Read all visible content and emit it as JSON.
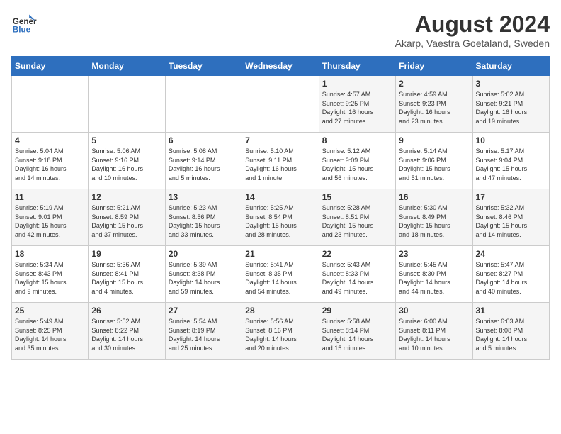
{
  "header": {
    "logo_line1": "General",
    "logo_line2": "Blue",
    "title": "August 2024",
    "location": "Akarp, Vaestra Goetaland, Sweden"
  },
  "days_of_week": [
    "Sunday",
    "Monday",
    "Tuesday",
    "Wednesday",
    "Thursday",
    "Friday",
    "Saturday"
  ],
  "weeks": [
    [
      {
        "day": "",
        "info": ""
      },
      {
        "day": "",
        "info": ""
      },
      {
        "day": "",
        "info": ""
      },
      {
        "day": "",
        "info": ""
      },
      {
        "day": "1",
        "info": "Sunrise: 4:57 AM\nSunset: 9:25 PM\nDaylight: 16 hours\nand 27 minutes."
      },
      {
        "day": "2",
        "info": "Sunrise: 4:59 AM\nSunset: 9:23 PM\nDaylight: 16 hours\nand 23 minutes."
      },
      {
        "day": "3",
        "info": "Sunrise: 5:02 AM\nSunset: 9:21 PM\nDaylight: 16 hours\nand 19 minutes."
      }
    ],
    [
      {
        "day": "4",
        "info": "Sunrise: 5:04 AM\nSunset: 9:18 PM\nDaylight: 16 hours\nand 14 minutes."
      },
      {
        "day": "5",
        "info": "Sunrise: 5:06 AM\nSunset: 9:16 PM\nDaylight: 16 hours\nand 10 minutes."
      },
      {
        "day": "6",
        "info": "Sunrise: 5:08 AM\nSunset: 9:14 PM\nDaylight: 16 hours\nand 5 minutes."
      },
      {
        "day": "7",
        "info": "Sunrise: 5:10 AM\nSunset: 9:11 PM\nDaylight: 16 hours\nand 1 minute."
      },
      {
        "day": "8",
        "info": "Sunrise: 5:12 AM\nSunset: 9:09 PM\nDaylight: 15 hours\nand 56 minutes."
      },
      {
        "day": "9",
        "info": "Sunrise: 5:14 AM\nSunset: 9:06 PM\nDaylight: 15 hours\nand 51 minutes."
      },
      {
        "day": "10",
        "info": "Sunrise: 5:17 AM\nSunset: 9:04 PM\nDaylight: 15 hours\nand 47 minutes."
      }
    ],
    [
      {
        "day": "11",
        "info": "Sunrise: 5:19 AM\nSunset: 9:01 PM\nDaylight: 15 hours\nand 42 minutes."
      },
      {
        "day": "12",
        "info": "Sunrise: 5:21 AM\nSunset: 8:59 PM\nDaylight: 15 hours\nand 37 minutes."
      },
      {
        "day": "13",
        "info": "Sunrise: 5:23 AM\nSunset: 8:56 PM\nDaylight: 15 hours\nand 33 minutes."
      },
      {
        "day": "14",
        "info": "Sunrise: 5:25 AM\nSunset: 8:54 PM\nDaylight: 15 hours\nand 28 minutes."
      },
      {
        "day": "15",
        "info": "Sunrise: 5:28 AM\nSunset: 8:51 PM\nDaylight: 15 hours\nand 23 minutes."
      },
      {
        "day": "16",
        "info": "Sunrise: 5:30 AM\nSunset: 8:49 PM\nDaylight: 15 hours\nand 18 minutes."
      },
      {
        "day": "17",
        "info": "Sunrise: 5:32 AM\nSunset: 8:46 PM\nDaylight: 15 hours\nand 14 minutes."
      }
    ],
    [
      {
        "day": "18",
        "info": "Sunrise: 5:34 AM\nSunset: 8:43 PM\nDaylight: 15 hours\nand 9 minutes."
      },
      {
        "day": "19",
        "info": "Sunrise: 5:36 AM\nSunset: 8:41 PM\nDaylight: 15 hours\nand 4 minutes."
      },
      {
        "day": "20",
        "info": "Sunrise: 5:39 AM\nSunset: 8:38 PM\nDaylight: 14 hours\nand 59 minutes."
      },
      {
        "day": "21",
        "info": "Sunrise: 5:41 AM\nSunset: 8:35 PM\nDaylight: 14 hours\nand 54 minutes."
      },
      {
        "day": "22",
        "info": "Sunrise: 5:43 AM\nSunset: 8:33 PM\nDaylight: 14 hours\nand 49 minutes."
      },
      {
        "day": "23",
        "info": "Sunrise: 5:45 AM\nSunset: 8:30 PM\nDaylight: 14 hours\nand 44 minutes."
      },
      {
        "day": "24",
        "info": "Sunrise: 5:47 AM\nSunset: 8:27 PM\nDaylight: 14 hours\nand 40 minutes."
      }
    ],
    [
      {
        "day": "25",
        "info": "Sunrise: 5:49 AM\nSunset: 8:25 PM\nDaylight: 14 hours\nand 35 minutes."
      },
      {
        "day": "26",
        "info": "Sunrise: 5:52 AM\nSunset: 8:22 PM\nDaylight: 14 hours\nand 30 minutes."
      },
      {
        "day": "27",
        "info": "Sunrise: 5:54 AM\nSunset: 8:19 PM\nDaylight: 14 hours\nand 25 minutes."
      },
      {
        "day": "28",
        "info": "Sunrise: 5:56 AM\nSunset: 8:16 PM\nDaylight: 14 hours\nand 20 minutes."
      },
      {
        "day": "29",
        "info": "Sunrise: 5:58 AM\nSunset: 8:14 PM\nDaylight: 14 hours\nand 15 minutes."
      },
      {
        "day": "30",
        "info": "Sunrise: 6:00 AM\nSunset: 8:11 PM\nDaylight: 14 hours\nand 10 minutes."
      },
      {
        "day": "31",
        "info": "Sunrise: 6:03 AM\nSunset: 8:08 PM\nDaylight: 14 hours\nand 5 minutes."
      }
    ]
  ]
}
